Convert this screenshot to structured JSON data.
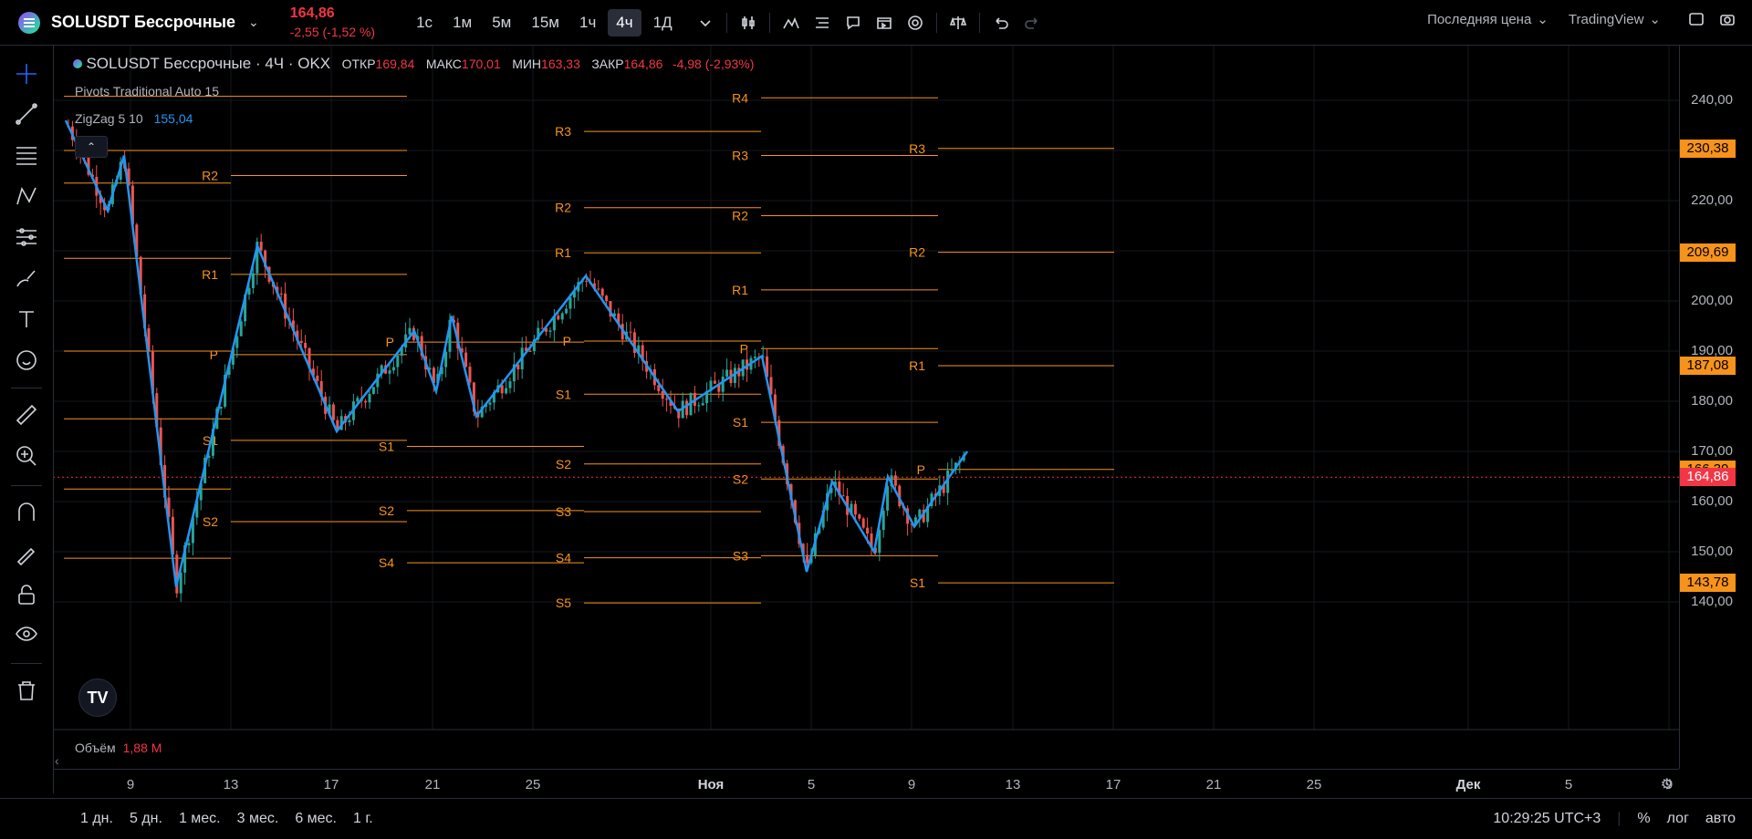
{
  "header": {
    "symbol": "SOLUSDT Бессрочные",
    "last_price": "164,86",
    "change": "-2,55 (-1,52 %)",
    "timeframes": [
      {
        "label": "1с",
        "active": false
      },
      {
        "label": "1м",
        "active": false
      },
      {
        "label": "5м",
        "active": false
      },
      {
        "label": "15м",
        "active": false
      },
      {
        "label": "1ч",
        "active": false
      },
      {
        "label": "4ч",
        "active": true
      },
      {
        "label": "1Д",
        "active": false
      }
    ],
    "price_type": "Последняя цена",
    "broker": "TradingView"
  },
  "legend": {
    "title": "SOLUSDT Бессрочные · 4Ч · OKX",
    "open_label": "ОТКР",
    "open": "169,84",
    "high_label": "МАКС",
    "high": "170,01",
    "low_label": "МИН",
    "low": "163,33",
    "close_label": "ЗАКР",
    "close": "164,86",
    "change": "-4,98 (-2,93%)"
  },
  "indicators": {
    "pivots": "Pivots Traditional Auto 15",
    "zigzag": "ZigZag 5 10",
    "zigzag_value": "155,04"
  },
  "volume": {
    "label": "Объём",
    "value": "1,88 M"
  },
  "price_axis": {
    "ticks": [
      "240,00",
      "230,00",
      "220,00",
      "210,00",
      "200,00",
      "190,00",
      "180,00",
      "170,00",
      "160,00",
      "150,00",
      "140,00"
    ],
    "labels": [
      {
        "text": "230,38",
        "color": "#f7931a"
      },
      {
        "text": "209,69",
        "color": "#f7931a"
      },
      {
        "text": "187,08",
        "color": "#f7931a"
      },
      {
        "text": "166,39",
        "color": "#f7931a"
      },
      {
        "text": "164,86",
        "color": "#f23645"
      },
      {
        "text": "143,78",
        "color": "#f7931a"
      }
    ]
  },
  "time_axis": {
    "labels": [
      {
        "text": "9",
        "bold": false
      },
      {
        "text": "13",
        "bold": false
      },
      {
        "text": "17",
        "bold": false
      },
      {
        "text": "21",
        "bold": false
      },
      {
        "text": "25",
        "bold": false
      },
      {
        "text": "Ноя",
        "bold": true
      },
      {
        "text": "5",
        "bold": false
      },
      {
        "text": "9",
        "bold": false
      },
      {
        "text": "13",
        "bold": false
      },
      {
        "text": "17",
        "bold": false
      },
      {
        "text": "21",
        "bold": false
      },
      {
        "text": "25",
        "bold": false
      },
      {
        "text": "Дек",
        "bold": true
      },
      {
        "text": "5",
        "bold": false
      },
      {
        "text": "9",
        "bold": false
      }
    ]
  },
  "pivots": {
    "labels": [
      "R4",
      "R3",
      "R2",
      "R1",
      "P",
      "S1",
      "S2",
      "S3",
      "S4",
      "S5"
    ]
  },
  "bottom": {
    "ranges": [
      "1 дн.",
      "5 дн.",
      "1 мес.",
      "3 мес.",
      "6 мес.",
      "1 г."
    ],
    "clock": "10:29:25 UTC+3",
    "percent": "%",
    "log": "лог",
    "auto": "авто"
  },
  "colors": {
    "pivot": "#f7931a",
    "zigzag": "#2196f3",
    "up": "#26a69a",
    "down": "#ef5350"
  }
}
